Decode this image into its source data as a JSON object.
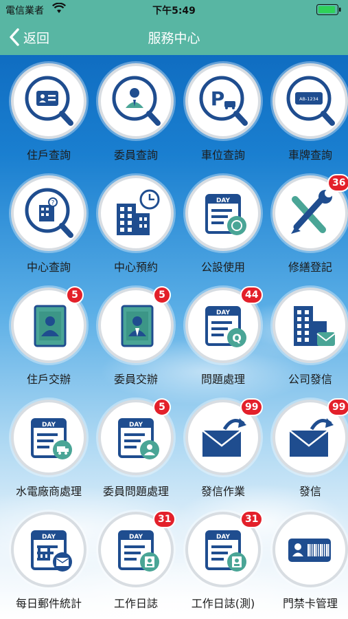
{
  "status_bar": {
    "carrier": "電信業者",
    "time": "下午5:49"
  },
  "nav": {
    "back_label": "返回",
    "title": "服務中心"
  },
  "colors": {
    "header": "#58b6a3",
    "icon_navy": "#1f4d8f",
    "icon_teal": "#4aa596",
    "badge": "#e3202a"
  },
  "tiles": [
    {
      "label": "住戶查詢",
      "icon": "resident-search-icon",
      "badge": ""
    },
    {
      "label": "委員查詢",
      "icon": "committee-search-icon",
      "badge": ""
    },
    {
      "label": "車位查詢",
      "icon": "parking-search-icon",
      "badge": ""
    },
    {
      "label": "車牌查詢",
      "icon": "license-plate-search-icon",
      "badge": ""
    },
    {
      "label": "中心查詢",
      "icon": "building-search-icon",
      "badge": ""
    },
    {
      "label": "中心預約",
      "icon": "building-clock-icon",
      "badge": ""
    },
    {
      "label": "公設使用",
      "icon": "facility-calendar-icon",
      "badge": ""
    },
    {
      "label": "修繕登記",
      "icon": "wrench-screwdriver-icon",
      "badge": "36"
    },
    {
      "label": "住戶交辦",
      "icon": "resident-folder-icon",
      "badge": "5"
    },
    {
      "label": "委員交辦",
      "icon": "committee-folder-icon",
      "badge": "5"
    },
    {
      "label": "問題處理",
      "icon": "calendar-question-icon",
      "badge": "44"
    },
    {
      "label": "公司發信",
      "icon": "company-mail-icon",
      "badge": ""
    },
    {
      "label": "水電廠商處理",
      "icon": "calendar-truck-icon",
      "badge": ""
    },
    {
      "label": "委員問題處理",
      "icon": "calendar-person-icon",
      "badge": "5"
    },
    {
      "label": "發信作業",
      "icon": "envelope-send-icon",
      "badge": "99"
    },
    {
      "label": "發信",
      "icon": "envelope-send-icon",
      "badge": "99"
    },
    {
      "label": "每日郵件統計",
      "icon": "chart-mail-icon",
      "badge": ""
    },
    {
      "label": "工作日誌",
      "icon": "calendar-id-icon",
      "badge": "31"
    },
    {
      "label": "工作日誌(測)",
      "icon": "calendar-id-icon",
      "badge": "31"
    },
    {
      "label": "門禁卡管理",
      "icon": "access-card-icon",
      "badge": ""
    }
  ],
  "icon_text": {
    "day": "DAY",
    "plate": "AB-1234"
  }
}
